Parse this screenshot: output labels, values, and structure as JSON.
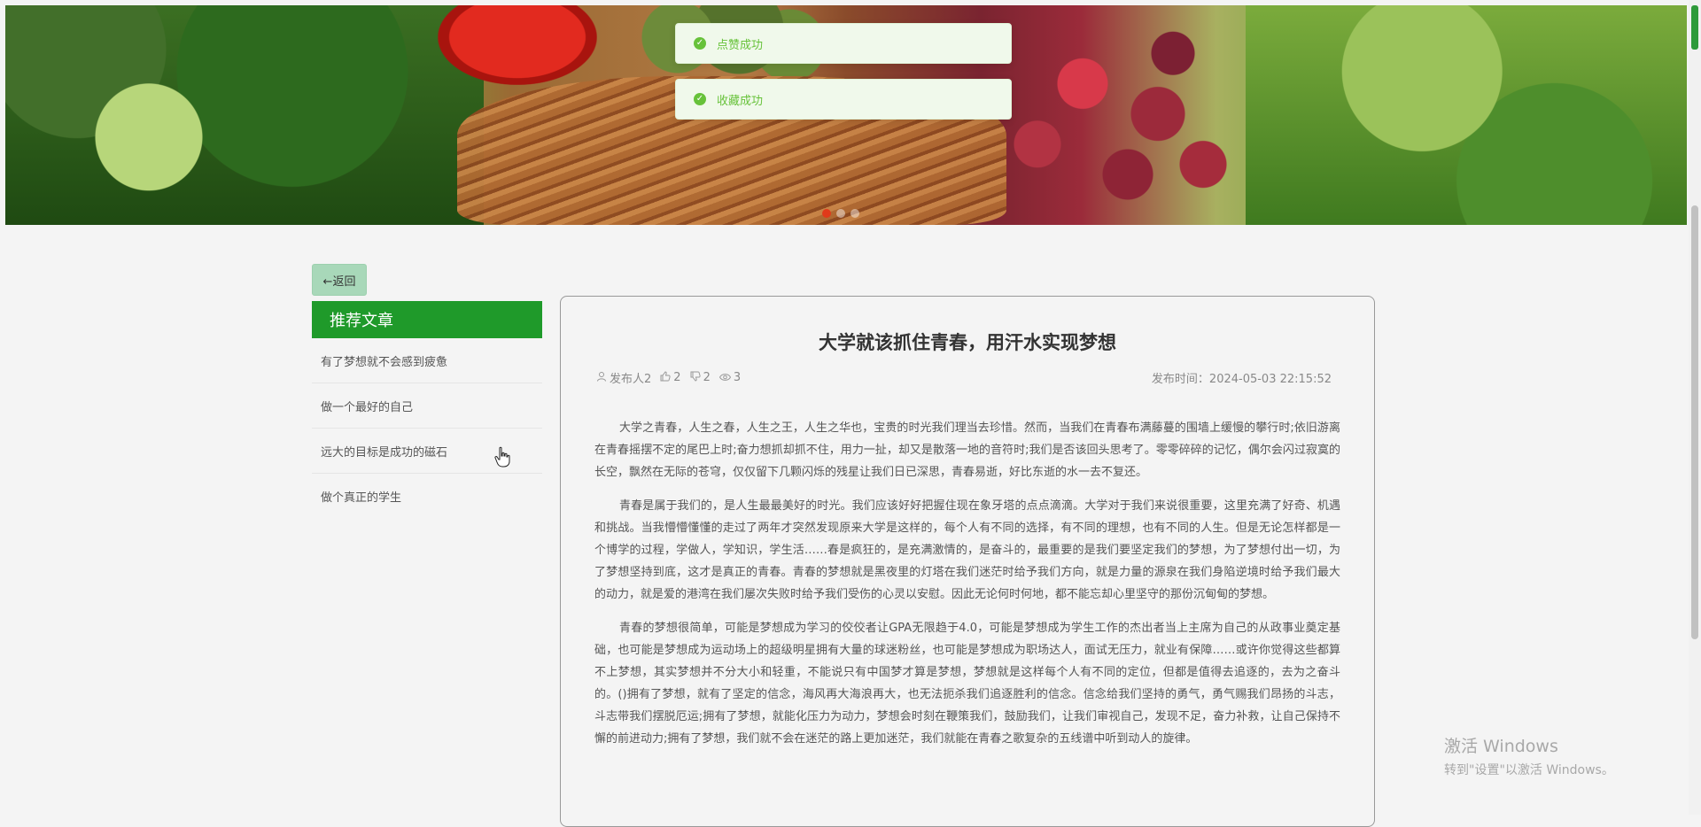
{
  "banner": {
    "dots": 3,
    "active_dot": 0
  },
  "toasts": [
    {
      "text": "点赞成功",
      "icon": "check-circle-icon",
      "color": "#67c23a"
    },
    {
      "text": "收藏成功",
      "icon": "check-circle-icon",
      "color": "#67c23a"
    }
  ],
  "back_button": {
    "label": "←返回"
  },
  "sidebar": {
    "heading": "推荐文章",
    "heading_color": "#1f9a2a",
    "items": [
      {
        "label": "有了梦想就不会感到疲惫"
      },
      {
        "label": "做一个最好的自己"
      },
      {
        "label": "远大的目标是成功的磁石"
      },
      {
        "label": "做个真正的学生"
      }
    ]
  },
  "article": {
    "title": "大学就该抓住青春，用汗水实现梦想",
    "author": "发布人2",
    "likes": "2",
    "dislikes": "2",
    "views": "3",
    "publish_time": "发布时间：2024-05-03 22:15:52",
    "paragraphs": [
      "大学之青春，人生之春，人生之王，人生之华也，宝贵的时光我们理当去珍惜。然而，当我们在青春布满藤蔓的围墙上缓慢的攀行时;依旧游离在青春摇摆不定的尾巴上时;奋力想抓却抓不住，用力一扯，却又是散落一地的音符时;我们是否该回头思考了。零零碎碎的记忆，偶尔会闪过寂寞的长空，飘然在无际的苍穹，仅仅留下几颗闪烁的残星让我们日已深思，青春易逝，好比东逝的水一去不复还。",
      "青春是属于我们的，是人生最最美好的时光。我们应该好好把握住现在象牙塔的点点滴滴。大学对于我们来说很重要，这里充满了好奇、机遇和挑战。当我懵懵懂懂的走过了两年才突然发现原来大学是这样的，每个人有不同的选择，有不同的理想，也有不同的人生。但是无论怎样都是一个博学的过程，学做人，学知识，学生活……春是疯狂的，是充满激情的，是奋斗的，最重要的是我们要坚定我们的梦想，为了梦想付出一切，为了梦想坚持到底，这才是真正的青春。青春的梦想就是黑夜里的灯塔在我们迷茫时给予我们方向，就是力量的源泉在我们身陷逆境时给予我们最大的动力，就是爱的港湾在我们屡次失败时给予我们受伤的心灵以安慰。因此无论何时何地，都不能忘却心里坚守的那份沉甸甸的梦想。",
      "青春的梦想很简单，可能是梦想成为学习的佼佼者让GPA无限趋于4.0，可能是梦想成为学生工作的杰出者当上主席为自己的从政事业奠定基础，也可能是梦想成为运动场上的超级明星拥有大量的球迷粉丝，也可能是梦想成为职场达人，面试无压力，就业有保障……或许你觉得这些都算不上梦想，其实梦想并不分大小和轻重，不能说只有中国梦才算是梦想，梦想就是这样每个人有不同的定位，但都是值得去追逐的，去为之奋斗的。()拥有了梦想，就有了坚定的信念，海风再大海浪再大，也无法扼杀我们追逐胜利的信念。信念给我们坚持的勇气，勇气赐我们昂扬的斗志，斗志带我们摆脱厄运;拥有了梦想，就能化压力为动力，梦想会时刻在鞭策我们，鼓励我们，让我们审视自己，发现不足，奋力补救，让自己保持不懈的前进动力;拥有了梦想，我们就不会在迷茫的路上更加迷茫，我们就能在青春之歌复杂的五线谱中听到动人的旋律。"
    ]
  },
  "watermark": {
    "line1": "激活 Windows",
    "line2": "转到\"设置\"以激活 Windows。"
  }
}
